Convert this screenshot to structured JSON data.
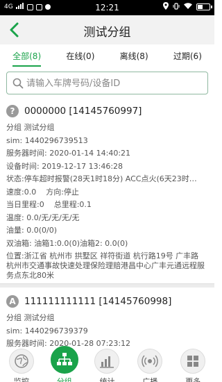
{
  "status_bar": {
    "network": "4G",
    "time": "12:21"
  },
  "header": {
    "title": "测试分组"
  },
  "tabs": [
    {
      "label": "全部(8)"
    },
    {
      "label": "在线(0)"
    },
    {
      "label": "离线(8)"
    },
    {
      "label": "过期(6)"
    }
  ],
  "search": {
    "placeholder": "请输入车牌号码/设备ID",
    "value": ""
  },
  "devices": [
    {
      "icon_letter": "?",
      "title": "0000000  [14145760997]",
      "group": "分组  测试分组",
      "sim": "sim: 1440296739513",
      "server_time": "服务器时间: 2020-01-14 14:40:21",
      "device_time": "设备时间: 2019-12-17 13:46:28",
      "status": "状态:停车超时报警(28天1时18分)  ACC点火(6天23时…",
      "speed": "速度:0.0",
      "direction": "方向:停止",
      "daily_mileage": "当日里程:0",
      "total_mileage": "总里程:0.1",
      "temperature": "温度: 0.0/无/无/无/无",
      "oil": "油量: 0.0(0/0)",
      "dual_oil": "双油箱: 油箱1:0.0(0)油箱2:    0.0(0)",
      "location": "位置:浙江省 杭州市 拱墅区 祥符街道 杭行路19号 广丰路 杭州市交通事故快速处理保险理赔港昌中心广丰元通远程服务点东北80米"
    },
    {
      "icon_letter": "A",
      "title": "111111111111  [14145760998]",
      "group": "分组  测试分组",
      "sim": "sim: 1440296739379",
      "server_time": "服务器时间: 2020-01-28 07:23:12"
    }
  ],
  "bottom_nav": [
    {
      "label": "监控",
      "icon": "globe-icon"
    },
    {
      "label": "分组",
      "icon": "org-tree-icon"
    },
    {
      "label": "统计",
      "icon": "bar-chart-icon"
    },
    {
      "label": "广播",
      "icon": "broadcast-icon"
    },
    {
      "label": "更多",
      "icon": "grid-icon"
    }
  ],
  "colors": {
    "accent": "#1aa34a",
    "header_bg": "#f2f2f2"
  }
}
